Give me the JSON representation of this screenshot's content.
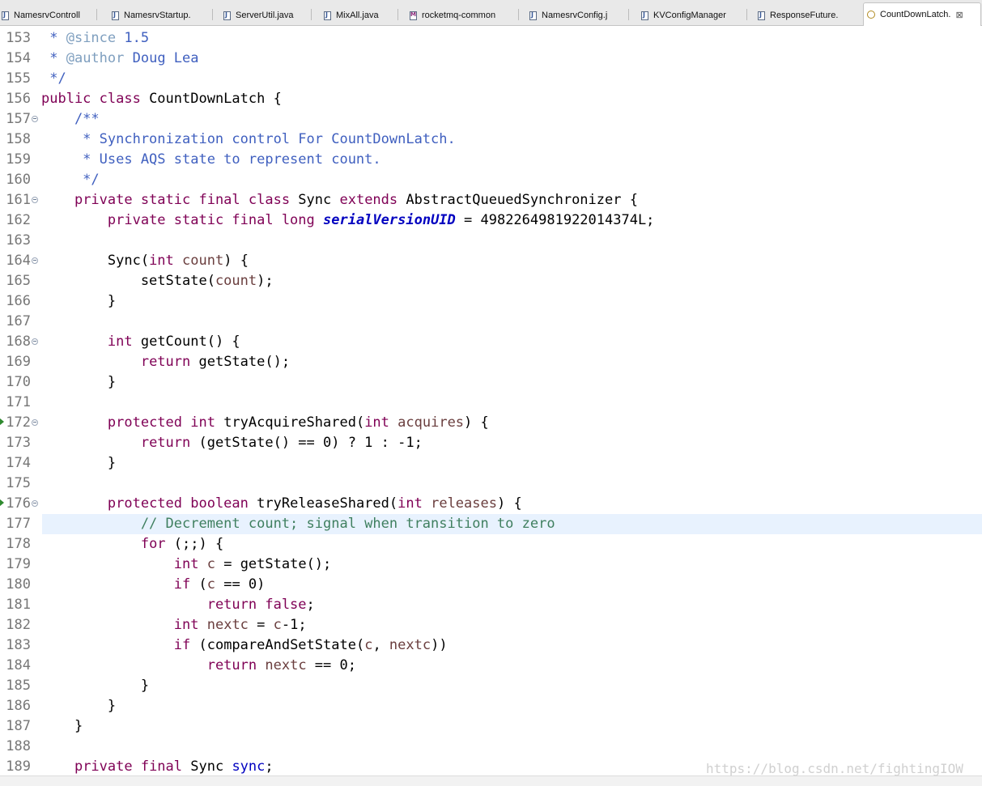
{
  "tabs": [
    {
      "label": "NamesrvControll",
      "icon": "java-file-icon"
    },
    {
      "label": "NamesrvStartup.",
      "icon": "java-file-icon"
    },
    {
      "label": "ServerUtil.java",
      "icon": "java-file-icon"
    },
    {
      "label": "MixAll.java",
      "icon": "java-file-icon"
    },
    {
      "label": "rocketmq-common",
      "icon": "maven-pom-icon"
    },
    {
      "label": "NamesrvConfig.j",
      "icon": "java-file-icon"
    },
    {
      "label": "KVConfigManager",
      "icon": "java-file-icon"
    },
    {
      "label": "ResponseFuture.",
      "icon": "java-file-icon"
    },
    {
      "label": "CountDownLatch.",
      "icon": "class-file-icon",
      "active": true,
      "close": "⊠"
    }
  ],
  "editor": {
    "highlighted_line": "177",
    "lines": [
      {
        "n": "153",
        "t": [
          {
            "c": "jd",
            "v": " * "
          },
          {
            "c": "jt",
            "v": "@since"
          },
          {
            "c": "jd",
            "v": " 1.5"
          }
        ]
      },
      {
        "n": "154",
        "t": [
          {
            "c": "jd",
            "v": " * "
          },
          {
            "c": "jt",
            "v": "@author"
          },
          {
            "c": "jd",
            "v": " Doug Lea"
          }
        ]
      },
      {
        "n": "155",
        "t": [
          {
            "c": "jd",
            "v": " */"
          }
        ]
      },
      {
        "n": "156",
        "t": [
          {
            "c": "kw",
            "v": "public class"
          },
          {
            "c": "",
            "v": " CountDownLatch {"
          }
        ]
      },
      {
        "n": "157",
        "fold": true,
        "t": [
          {
            "c": "jd",
            "v": "    /**"
          }
        ]
      },
      {
        "n": "158",
        "t": [
          {
            "c": "jd",
            "v": "     * Synchronization control For CountDownLatch."
          }
        ]
      },
      {
        "n": "159",
        "t": [
          {
            "c": "jd",
            "v": "     * Uses AQS state to represent count."
          }
        ]
      },
      {
        "n": "160",
        "t": [
          {
            "c": "jd",
            "v": "     */"
          }
        ]
      },
      {
        "n": "161",
        "fold": true,
        "t": [
          {
            "c": "",
            "v": "    "
          },
          {
            "c": "kw",
            "v": "private static final class"
          },
          {
            "c": "",
            "v": " Sync "
          },
          {
            "c": "kw",
            "v": "extends"
          },
          {
            "c": "",
            "v": " AbstractQueuedSynchronizer {"
          }
        ]
      },
      {
        "n": "162",
        "t": [
          {
            "c": "",
            "v": "        "
          },
          {
            "c": "kw",
            "v": "private static final long"
          },
          {
            "c": "",
            "v": " "
          },
          {
            "c": "sf",
            "v": "serialVersionUID"
          },
          {
            "c": "",
            "v": " = 4982264981922014374L;"
          }
        ]
      },
      {
        "n": "163",
        "t": []
      },
      {
        "n": "164",
        "fold": true,
        "t": [
          {
            "c": "",
            "v": "        Sync("
          },
          {
            "c": "kw",
            "v": "int"
          },
          {
            "c": "",
            "v": " "
          },
          {
            "c": "var",
            "v": "count"
          },
          {
            "c": "",
            "v": ") {"
          }
        ]
      },
      {
        "n": "165",
        "t": [
          {
            "c": "",
            "v": "            setState("
          },
          {
            "c": "var",
            "v": "count"
          },
          {
            "c": "",
            "v": ");"
          }
        ]
      },
      {
        "n": "166",
        "t": [
          {
            "c": "",
            "v": "        }"
          }
        ]
      },
      {
        "n": "167",
        "t": []
      },
      {
        "n": "168",
        "fold": true,
        "t": [
          {
            "c": "",
            "v": "        "
          },
          {
            "c": "kw",
            "v": "int"
          },
          {
            "c": "",
            "v": " getCount() {"
          }
        ]
      },
      {
        "n": "169",
        "t": [
          {
            "c": "",
            "v": "            "
          },
          {
            "c": "kw",
            "v": "return"
          },
          {
            "c": "",
            "v": " getState();"
          }
        ]
      },
      {
        "n": "170",
        "t": [
          {
            "c": "",
            "v": "        }"
          }
        ]
      },
      {
        "n": "171",
        "t": []
      },
      {
        "n": "172",
        "fold": true,
        "override": true,
        "t": [
          {
            "c": "",
            "v": "        "
          },
          {
            "c": "kw",
            "v": "protected int"
          },
          {
            "c": "",
            "v": " tryAcquireShared("
          },
          {
            "c": "kw",
            "v": "int"
          },
          {
            "c": "",
            "v": " "
          },
          {
            "c": "var",
            "v": "acquires"
          },
          {
            "c": "",
            "v": ") {"
          }
        ]
      },
      {
        "n": "173",
        "t": [
          {
            "c": "",
            "v": "            "
          },
          {
            "c": "kw",
            "v": "return"
          },
          {
            "c": "",
            "v": " (getState() == 0) ? 1 : -1;"
          }
        ]
      },
      {
        "n": "174",
        "t": [
          {
            "c": "",
            "v": "        }"
          }
        ]
      },
      {
        "n": "175",
        "t": []
      },
      {
        "n": "176",
        "fold": true,
        "override": true,
        "t": [
          {
            "c": "",
            "v": "        "
          },
          {
            "c": "kw",
            "v": "protected boolean"
          },
          {
            "c": "",
            "v": " tryReleaseShared("
          },
          {
            "c": "kw",
            "v": "int"
          },
          {
            "c": "",
            "v": " "
          },
          {
            "c": "var",
            "v": "releases"
          },
          {
            "c": "",
            "v": ") {"
          }
        ]
      },
      {
        "n": "177",
        "t": [
          {
            "c": "cm",
            "v": "            // Decrement count; signal when transition to zero"
          }
        ]
      },
      {
        "n": "178",
        "t": [
          {
            "c": "",
            "v": "            "
          },
          {
            "c": "kw",
            "v": "for"
          },
          {
            "c": "",
            "v": " (;;) {"
          }
        ]
      },
      {
        "n": "179",
        "t": [
          {
            "c": "",
            "v": "                "
          },
          {
            "c": "kw",
            "v": "int"
          },
          {
            "c": "",
            "v": " "
          },
          {
            "c": "var",
            "v": "c"
          },
          {
            "c": "",
            "v": " = getState();"
          }
        ]
      },
      {
        "n": "180",
        "t": [
          {
            "c": "",
            "v": "                "
          },
          {
            "c": "kw",
            "v": "if"
          },
          {
            "c": "",
            "v": " ("
          },
          {
            "c": "var",
            "v": "c"
          },
          {
            "c": "",
            "v": " == 0)"
          }
        ]
      },
      {
        "n": "181",
        "t": [
          {
            "c": "",
            "v": "                    "
          },
          {
            "c": "kw",
            "v": "return false"
          },
          {
            "c": "",
            "v": ";"
          }
        ]
      },
      {
        "n": "182",
        "t": [
          {
            "c": "",
            "v": "                "
          },
          {
            "c": "kw",
            "v": "int"
          },
          {
            "c": "",
            "v": " "
          },
          {
            "c": "var",
            "v": "nextc"
          },
          {
            "c": "",
            "v": " = "
          },
          {
            "c": "var",
            "v": "c"
          },
          {
            "c": "",
            "v": "-1;"
          }
        ]
      },
      {
        "n": "183",
        "t": [
          {
            "c": "",
            "v": "                "
          },
          {
            "c": "kw",
            "v": "if"
          },
          {
            "c": "",
            "v": " (compareAndSetState("
          },
          {
            "c": "var",
            "v": "c"
          },
          {
            "c": "",
            "v": ", "
          },
          {
            "c": "var",
            "v": "nextc"
          },
          {
            "c": "",
            "v": "))"
          }
        ]
      },
      {
        "n": "184",
        "t": [
          {
            "c": "",
            "v": "                    "
          },
          {
            "c": "kw",
            "v": "return"
          },
          {
            "c": "",
            "v": " "
          },
          {
            "c": "var",
            "v": "nextc"
          },
          {
            "c": "",
            "v": " == 0;"
          }
        ]
      },
      {
        "n": "185",
        "t": [
          {
            "c": "",
            "v": "            }"
          }
        ]
      },
      {
        "n": "186",
        "t": [
          {
            "c": "",
            "v": "        }"
          }
        ]
      },
      {
        "n": "187",
        "t": [
          {
            "c": "",
            "v": "    }"
          }
        ]
      },
      {
        "n": "188",
        "t": []
      },
      {
        "n": "189",
        "t": [
          {
            "c": "",
            "v": "    "
          },
          {
            "c": "kw",
            "v": "private final"
          },
          {
            "c": "",
            "v": " Sync "
          },
          {
            "c": "fld",
            "v": "sync"
          },
          {
            "c": "",
            "v": ";"
          }
        ]
      }
    ]
  },
  "watermark": "https://blog.csdn.net/fightingIOW",
  "colors": {
    "keyword": "#7f0055",
    "javadoc": "#3f5fbf",
    "javadoc_tag": "#7f9fbf",
    "comment": "#3f7f5f",
    "field": "#0000c0",
    "local_variable": "#6a3e3e",
    "current_line": "#e8f2fe"
  }
}
